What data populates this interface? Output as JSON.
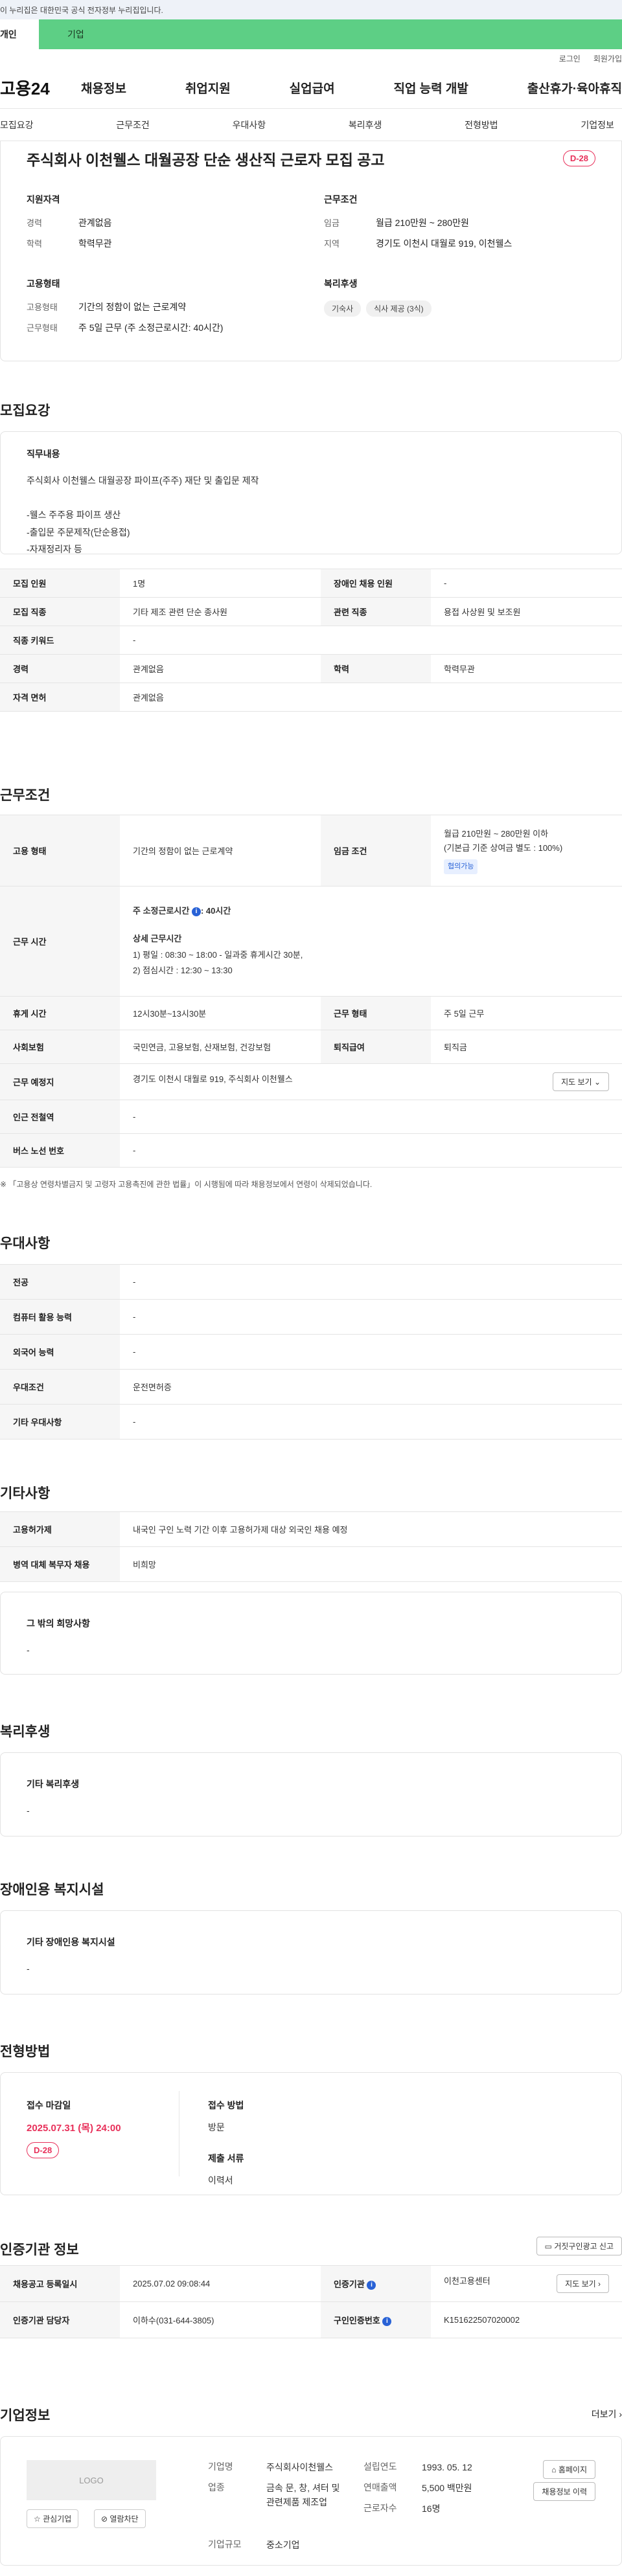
{
  "gov_banner": "이 누리집은 대한민국 공식 전자정부 누리집입니다.",
  "tabs": {
    "personal": "개인",
    "company": "기업"
  },
  "util": {
    "login": "로그인",
    "signup": "회원가입"
  },
  "logo": "고용24",
  "gnb": [
    "채용정보",
    "취업지원",
    "실업급여",
    "직업 능력 개발",
    "출산휴가·육아휴직"
  ],
  "anchors": [
    "모집요강",
    "근무조건",
    "우대사항",
    "복리후생",
    "전형방법",
    "기업정보"
  ],
  "summary": {
    "title": "주식회사 이천웰스 대월공장 단순 생산직 근로자 모집 공고",
    "dday": "D-28",
    "qualification": {
      "heading": "지원자격",
      "career_k": "경력",
      "career_v": "관계없음",
      "edu_k": "학력",
      "edu_v": "학력무관"
    },
    "conditions": {
      "heading": "근무조건",
      "wage_k": "임금",
      "wage_v": "월급 210만원 ~ 280만원",
      "region_k": "지역",
      "region_v": "경기도 이천시 대월로 919, 이천웰스"
    },
    "employment": {
      "heading": "고용형태",
      "type_k": "고용형태",
      "type_v": "기간의 정함이 없는 근로계약",
      "form_k": "근무형태",
      "form_v": "주 5일 근무 (주 소정근로시간: 40시간)"
    },
    "welfare": {
      "heading": "복리후생",
      "chips": [
        "기숙사",
        "식사 제공 (3식)"
      ]
    }
  },
  "recruit": {
    "heading": "모집요강",
    "duty_heading": "직무내용",
    "duty_text": "주식회사 이천웰스 대월공장 파이프(주주) 재단 및 출입문 제작\n\n-웰스 주주용 파이프 생산\n-출입문 주문제작(단순용접)\n-자재정리자 등",
    "rows": [
      {
        "k1": "모집 인원",
        "v1": "1명",
        "k2": "장애인 채용 인원",
        "v2": "-"
      },
      {
        "k1": "모집 직종",
        "v1": "기타 제조 관련 단순 종사원",
        "k2": "관련 직종",
        "v2": "용접 사상원 및 보조원"
      },
      {
        "k1": "직종 키워드",
        "v1": "-"
      },
      {
        "k1": "경력",
        "v1": "관계없음",
        "k2": "학력",
        "v2": "학력무관"
      },
      {
        "k1": "자격 면허",
        "v1": "관계없음"
      }
    ]
  },
  "work": {
    "heading": "근무조건",
    "type_k": "고용 형태",
    "type_v": "기간의 정함이 없는 근로계약",
    "wage_k": "임금 조건",
    "wage_v1": "월급 210만원 ~ 280만원 이하",
    "wage_v2": "(기본급 기준 상여금 별도 : 100%)",
    "wage_badge": "협의가능",
    "hours_k": "근무 시간",
    "hours_weekly": "주 소정근로시간 ",
    "hours_weekly_v": ": 40시간",
    "hours_detail_h": "상세 근무시간",
    "hours_detail_1": "1) 평일 : 08:30 ~ 18:00  - 일과중 휴게시간 30분,",
    "hours_detail_2": "2) 점심시간 : 12:30 ~ 13:30",
    "break_k": "휴게 시간",
    "break_v": "12시30분~13시30분",
    "form_k": "근무 형태",
    "form_v": "주 5일 근무",
    "ins_k": "사회보험",
    "ins_v": "국민연금, 고용보험, 산재보험, 건강보험",
    "sev_k": "퇴직급여",
    "sev_v": "퇴직금",
    "place_k": "근무 예정지",
    "place_v": "경기도 이천시 대월로 919, 주식회사 이천웰스",
    "map_btn": "지도 보기",
    "station_k": "인근 전철역",
    "station_v": "-",
    "bus_k": "버스 노선 번호",
    "bus_v": "-",
    "note": "※ 「고용상 연령차별금지 및 고령자 고용촉진에 관한 법률」이 시행됨에 따라 채용정보에서 연령이 삭제되었습니다."
  },
  "pref": {
    "heading": "우대사항",
    "rows": [
      {
        "k": "전공",
        "v": "-"
      },
      {
        "k": "컴퓨터 활용 능력",
        "v": "-"
      },
      {
        "k": "외국어 능력",
        "v": "-"
      },
      {
        "k": "우대조건",
        "v": "운전면허증"
      },
      {
        "k": "기타 우대사항",
        "v": "-"
      }
    ]
  },
  "etc": {
    "heading": "기타사항",
    "rows": [
      {
        "k": "고용허가제",
        "v": "내국인 구인 노력 기간 이후 고용허가제 대상 외국인 채용 예정"
      },
      {
        "k": "병역 대체 복무자 채용",
        "v": "비희망"
      }
    ],
    "other_h": "그 밖의 희망사항",
    "other_v": "-"
  },
  "welfare": {
    "heading": "복리후생",
    "box_h": "기타 복리후생",
    "box_v": "-"
  },
  "disabled": {
    "heading": "장애인용 복지시설",
    "box_h": "기타 장애인용 복지시설",
    "box_v": "-"
  },
  "apply": {
    "heading": "전형방법",
    "deadline_h": "접수 마감일",
    "deadline_v": "2025.07.31 (목) 24:00",
    "dday": "D-28",
    "method_h": "접수 방법",
    "method_v": "방문",
    "docs_h": "제출 서류",
    "docs_v": "이력서"
  },
  "agency": {
    "heading": "인증기관 정보",
    "report_btn": "거짓구인광고 신고",
    "date_k": "채용공고 등록일시",
    "date_v": "2025.07.02 09:08:44",
    "org_k": "인증기관",
    "org_v": "이천고용센터",
    "map_btn": "지도 보기",
    "mgr_k": "인증기관 담당자",
    "mgr_v": "이하수(031-644-3805)",
    "no_k": "구인인증번호",
    "no_v": "K151622507020002"
  },
  "company": {
    "heading": "기업정보",
    "more": "더보기",
    "logo": "LOGO",
    "fav_btn": "관심기업",
    "block_btn": "열람차단",
    "name_k": "기업명",
    "name_v": "주식회사이천웰스",
    "industry_k": "업종",
    "industry_v": "금속 문, 창, 셔터 및 관련제품 제조업",
    "size_k": "기업규모",
    "size_v": "중소기업",
    "year_k": "설립연도",
    "year_v": "1993. 05. 12",
    "sales_k": "연매출액",
    "sales_v": "5,500 백만원",
    "emp_k": "근로자수",
    "emp_v": "16명",
    "home_btn": "홈페이지",
    "jobs_btn": "채용정보 이력"
  }
}
